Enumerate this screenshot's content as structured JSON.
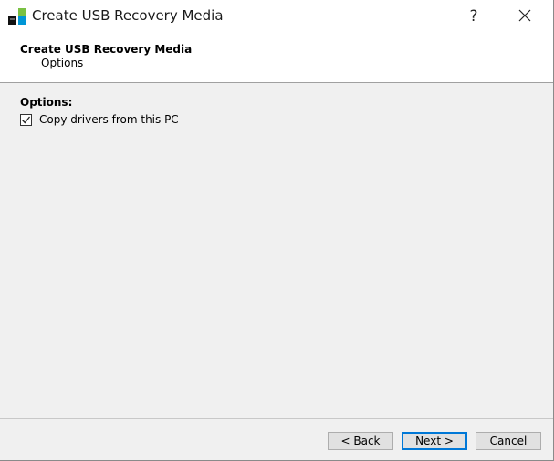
{
  "window": {
    "title": "Create USB Recovery Media",
    "help_label": "?",
    "icons": {
      "app": "app-icon",
      "close": "close-icon"
    }
  },
  "header": {
    "title": "Create USB Recovery Media",
    "subtitle": "Options"
  },
  "content": {
    "section_label": "Options:",
    "checkbox": {
      "label": "Copy drivers from this PC",
      "checked": true
    }
  },
  "footer": {
    "back_label": "< Back",
    "next_label": "Next >",
    "cancel_label": "Cancel"
  },
  "colors": {
    "accent": "#0078d7",
    "icon_green": "#7ac143",
    "icon_blue": "#0096d6"
  }
}
